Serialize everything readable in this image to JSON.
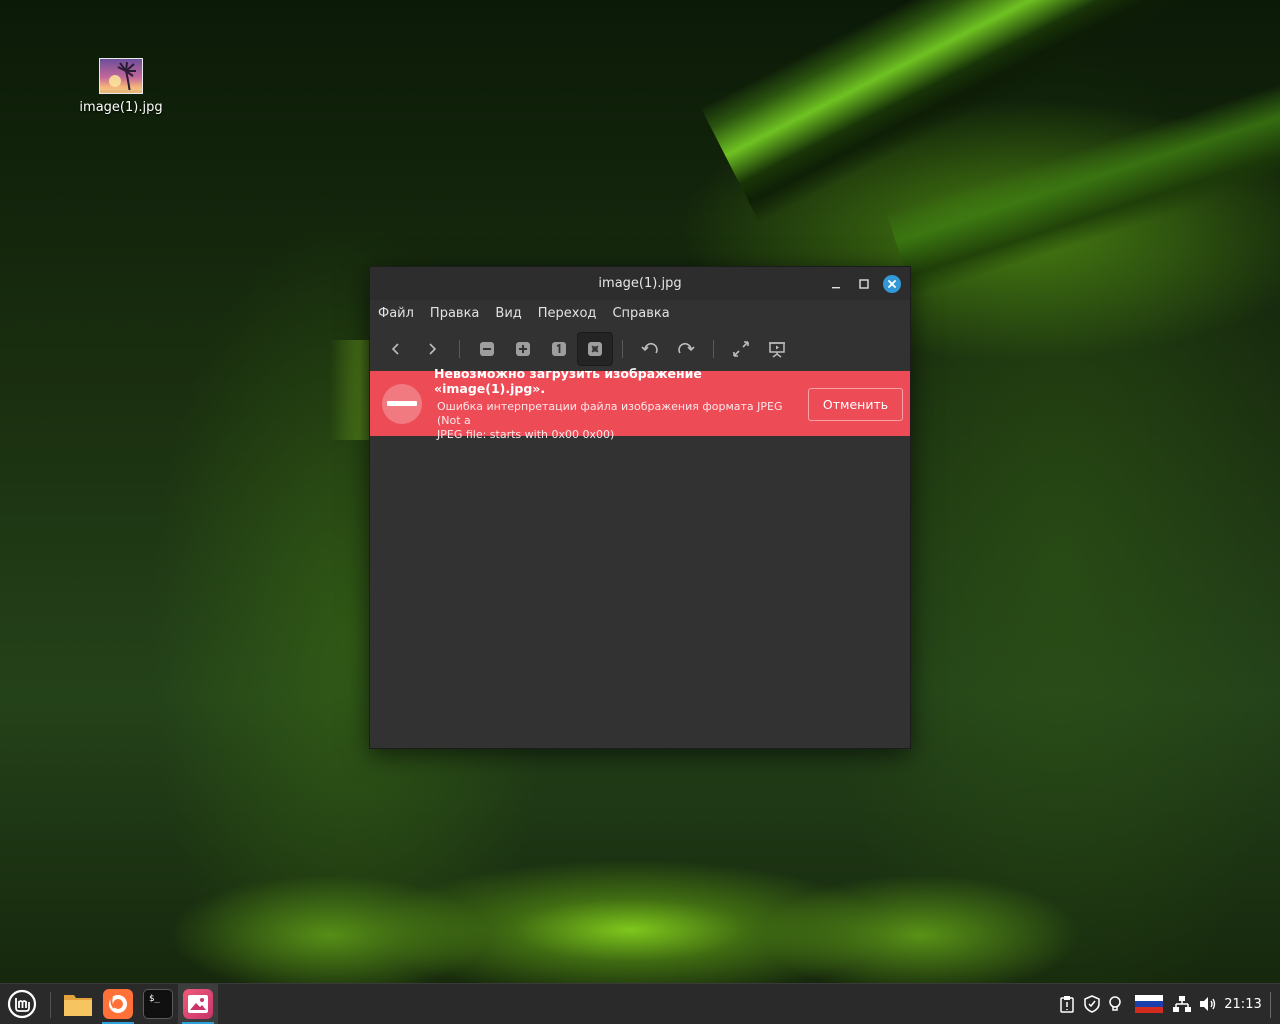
{
  "desktop": {
    "icon_label": "image(1).jpg"
  },
  "window": {
    "title": "image(1).jpg",
    "menu": [
      "Файл",
      "Правка",
      "Вид",
      "Переход",
      "Справка"
    ],
    "error": {
      "title": "Невозможно загрузить изображение «image(1).jpg».",
      "detail_line1": "Ошибка интерпретации файла изображения формата JPEG (Not a",
      "detail_line2": "JPEG file: starts with 0x00 0x00)",
      "cancel_label": "Отменить",
      "color": "#ed4b56"
    }
  },
  "taskbar": {
    "clock": "21:13",
    "accent": "#2f9fd8",
    "apps": [
      "files-icon",
      "firefox-icon",
      "terminal-icon",
      "image-viewer-icon"
    ]
  }
}
